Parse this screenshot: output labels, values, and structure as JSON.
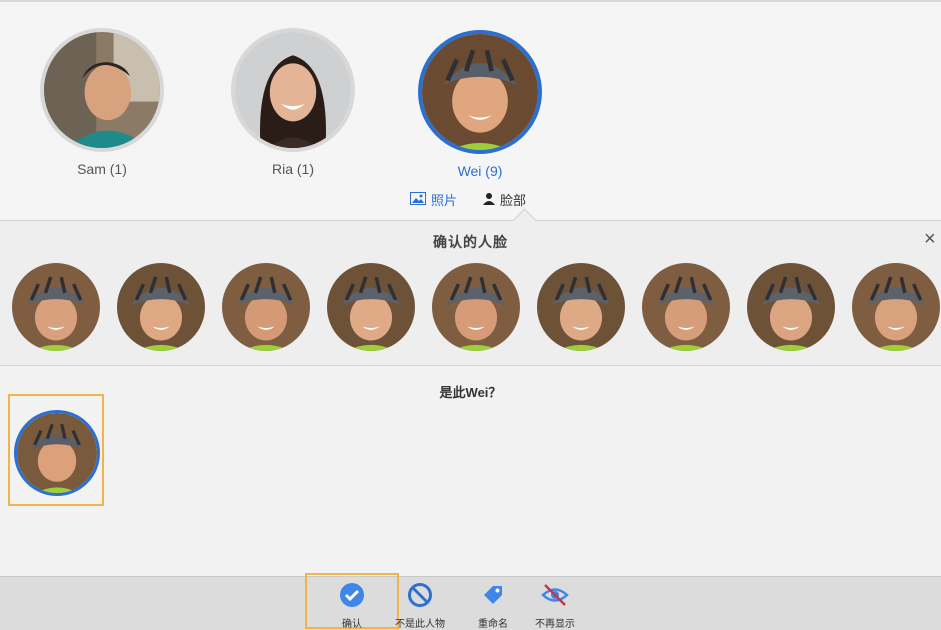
{
  "people": [
    {
      "name": "Sam (1)",
      "selected": false
    },
    {
      "name": "Ria (1)",
      "selected": false
    },
    {
      "name": "Wei (9)",
      "selected": true
    }
  ],
  "tabs": {
    "photos": "照片",
    "faces": "脸部"
  },
  "confirmed_section": {
    "title": "确认的人脸",
    "close": "×",
    "face_count": 9
  },
  "question_section": {
    "title": "是此Wei？"
  },
  "toolbar": {
    "confirm": "确认",
    "not_person": "不是此人物",
    "rename": "重命名",
    "hide": "不再显示"
  },
  "colors": {
    "accent": "#2b6fd1",
    "highlight": "#f0b44a"
  }
}
